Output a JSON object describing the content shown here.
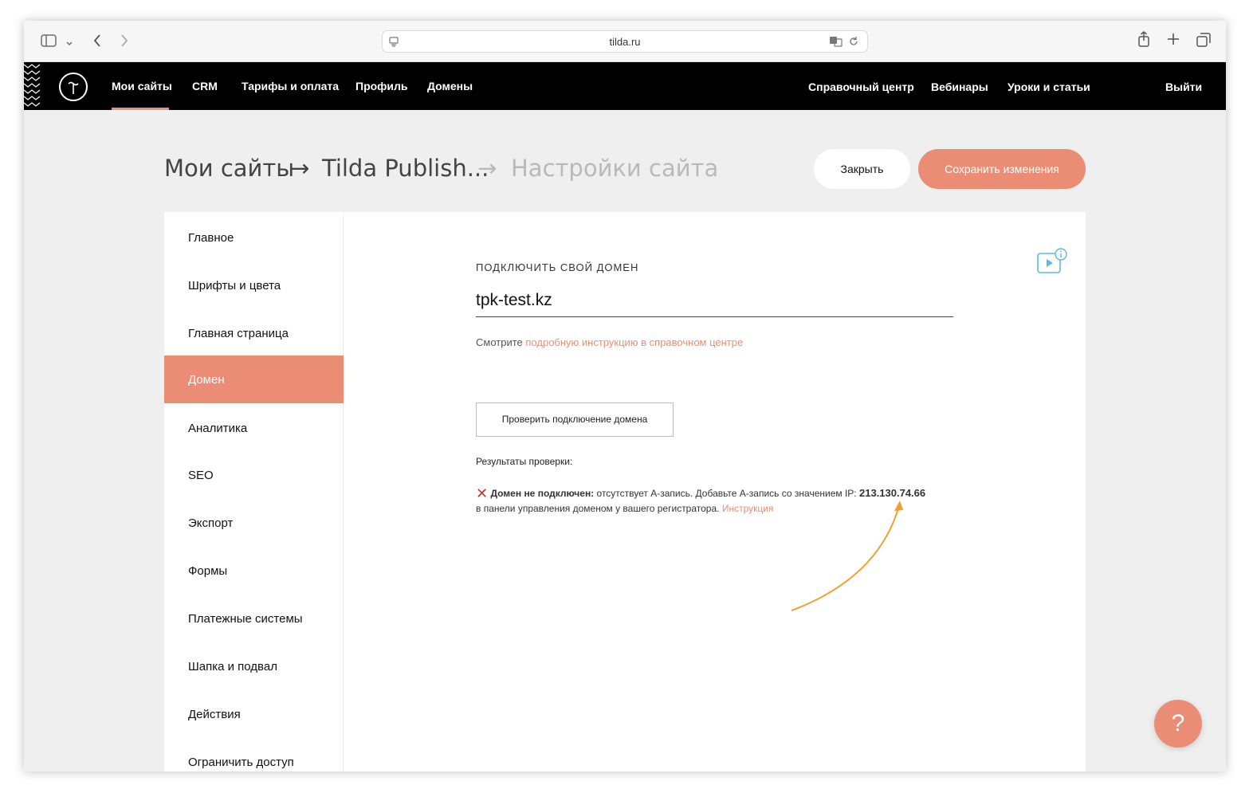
{
  "browser": {
    "url": "tilda.ru",
    "icons": [
      "sidebar-icon",
      "chevron-down-icon",
      "back-icon",
      "forward-icon",
      "page-icon",
      "translate-icon",
      "reload-icon",
      "share-icon",
      "plus-icon",
      "tabs-icon"
    ]
  },
  "topnav": {
    "items": [
      "Мои сайты",
      "CRM",
      "Тарифы и оплата",
      "Профиль",
      "Домены"
    ],
    "right_items": [
      "Справочный центр",
      "Вебинары",
      "Уроки и статьи"
    ],
    "logout": "Выйти",
    "active_index": 0
  },
  "header": {
    "crumb1": "Мои сайты",
    "crumb2": "Tilda Publish...",
    "crumb3": "Настройки сайта",
    "arrow": "→",
    "close_label": "Закрыть",
    "save_label": "Сохранить изменения"
  },
  "sidebar": {
    "items": [
      "Главное",
      "Шрифты и цвета",
      "Главная страница",
      "Домен",
      "Аналитика",
      "SEO",
      "Экспорт",
      "Формы",
      "Платежные системы",
      "Шапка и подвал",
      "Действия",
      "Ограничить доступ"
    ],
    "active_index": 3
  },
  "domain": {
    "label": "Подключить свой домен",
    "value": "tpk-test.kz",
    "hint_prefix": "Смотрите",
    "hint_link": "подробную инструкцию в справочном центре",
    "check_button": "Проверить подключение домена",
    "results_label": "Результаты проверки:",
    "error_title": "Домен не подключен:",
    "error_text": "отсутствует A-запись. Добавьте A-запись со значением IP:",
    "ip": "213.130.74.66",
    "error_text2": "в панели управления доменом у вашего регистратора.",
    "instruction_link": "Инструкция"
  },
  "help": {
    "label": "?"
  },
  "colors": {
    "accent": "#ea8d74",
    "arrow": "#f0a030",
    "error": "#e12b2b",
    "video_icon": "#5bbbe0"
  }
}
